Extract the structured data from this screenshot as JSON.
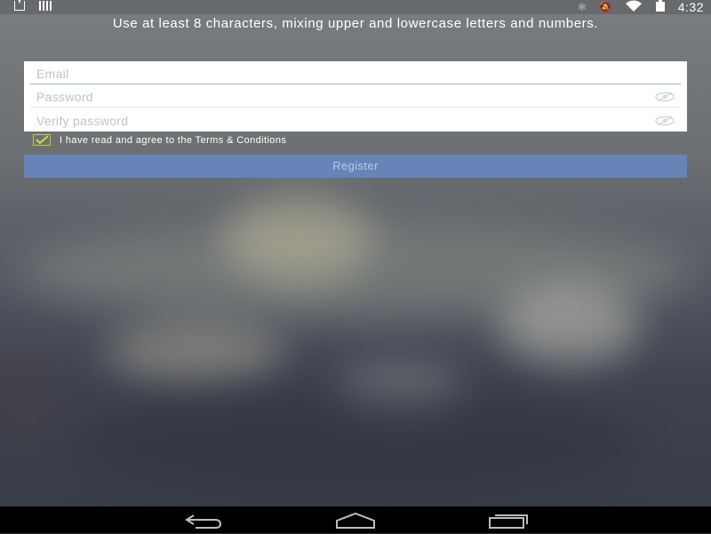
{
  "status_bar": {
    "time": "4:32",
    "icons": [
      "download-icon",
      "signal-bars-icon",
      "bluetooth-icon",
      "mute-icon",
      "wifi-icon",
      "battery-icon"
    ]
  },
  "hint": {
    "text": "Use at least 8 characters, mixing upper and lowercase letters and numbers."
  },
  "form": {
    "email": {
      "placeholder": "Email",
      "value": ""
    },
    "password": {
      "placeholder": "Password",
      "value": ""
    },
    "verify_password": {
      "placeholder": "Verify password",
      "value": ""
    }
  },
  "terms": {
    "checked": true,
    "label": "I have read and agree to the Terms & Conditions"
  },
  "register": {
    "label": "Register"
  },
  "nav_bar": {
    "buttons": [
      "back-icon",
      "home-icon",
      "recents-icon"
    ]
  },
  "colors": {
    "register_bg": "#6784b8",
    "checkbox_check": "#c9c63c",
    "navbar_bg": "#000000"
  }
}
